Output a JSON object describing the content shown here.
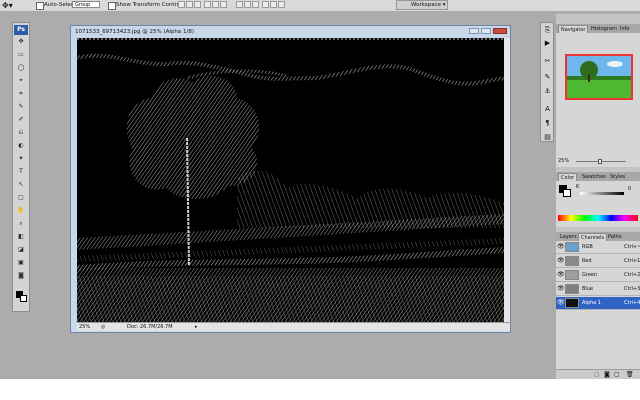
{
  "options_bar": {
    "tool_icon": "move-tool-icon",
    "auto_select_label": "Auto-Select:",
    "auto_select_value": "Group",
    "transform_label": "Show Transform Controls",
    "workspace_label": "Workspace"
  },
  "tools_panel": {
    "logo": "Ps",
    "tool_glyphs": [
      "✥",
      "▭",
      "◯",
      "⌖",
      "⌗",
      "✎",
      "✐",
      "⎌",
      "◐",
      "✦",
      "T",
      "↖",
      "▢",
      "✋",
      "⌕",
      "◧",
      "◪",
      "▣",
      "◙"
    ]
  },
  "document": {
    "title": "1071533_69713423.jpg @ 25% (Alpha 1/8)",
    "zoom": "25%",
    "doc_info": "Doc: 26.7M/26.7M"
  },
  "navigator": {
    "tabs": [
      "Navigator",
      "Histogram",
      "Info"
    ],
    "zoom": "25%"
  },
  "color_panel": {
    "tabs": [
      "Color",
      "Swatches",
      "Styles"
    ],
    "channel_label": "K",
    "channel_value": "0"
  },
  "channels_panel": {
    "tabs": [
      "Layers",
      "Channels",
      "Paths"
    ],
    "rows": [
      {
        "name": "RGB",
        "shortcut": "Ctrl+~",
        "thumb": "#6aa0c8",
        "eye": "visible-eye"
      },
      {
        "name": "Red",
        "shortcut": "Ctrl+1",
        "thumb": "#8a8a8a",
        "eye": "visible-eye"
      },
      {
        "name": "Green",
        "shortcut": "Ctrl+2",
        "thumb": "#9d9d9d",
        "eye": "visible-eye"
      },
      {
        "name": "Blue",
        "shortcut": "Ctrl+3",
        "thumb": "#7f7f7f",
        "eye": "visible-eye"
      },
      {
        "name": "Alpha 1",
        "shortcut": "Ctrl+4",
        "thumb": "#111111",
        "eye": "visible-eye"
      }
    ]
  },
  "colors": {
    "app_bg": "#acacac",
    "panel_bg": "#d6d6d6",
    "selected_row": "#2f63c4",
    "nav_border": "#e33333"
  }
}
